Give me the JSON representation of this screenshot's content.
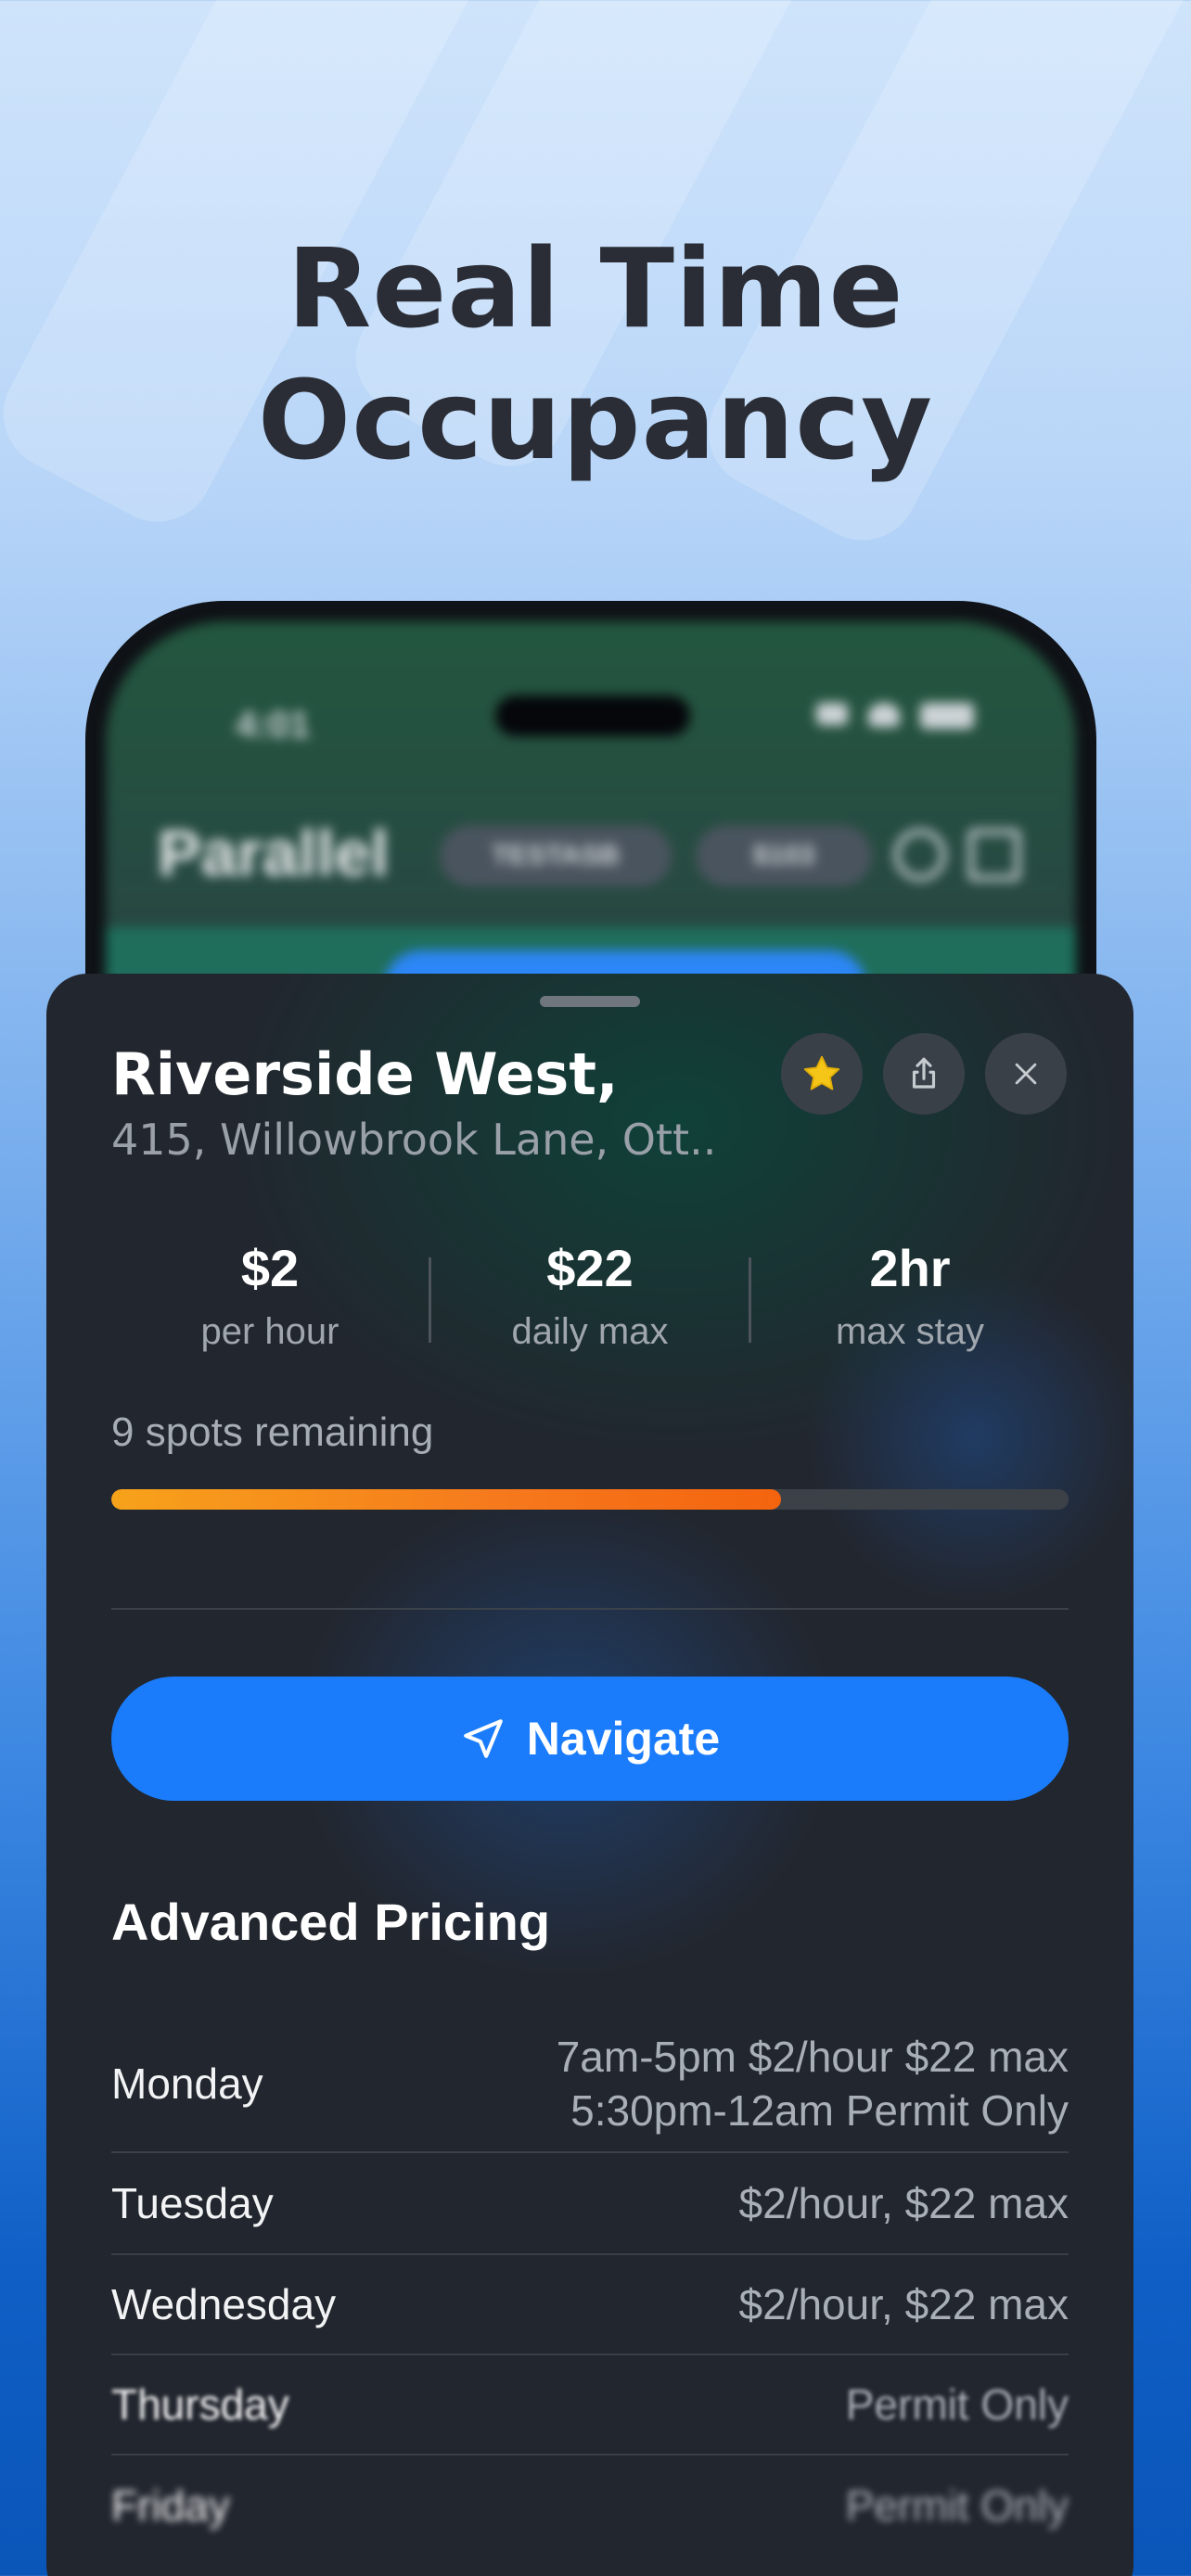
{
  "headline": {
    "line1": "Real Time",
    "line2": "Occupancy"
  },
  "phone": {
    "status_time": "4:01",
    "app_name": "Parallel",
    "chips": [
      "TESTASB",
      "$103"
    ]
  },
  "sheet": {
    "place_name": "Riverside West,",
    "address": "415, Willowbrook Lane, Ott..",
    "buttons": {
      "favorite": "star-icon",
      "share": "share-icon",
      "close": "close-icon"
    },
    "stats": [
      {
        "value": "$2",
        "label": "per hour"
      },
      {
        "value": "$22",
        "label": "daily max"
      },
      {
        "value": "2hr",
        "label": "max stay"
      }
    ],
    "spots_text": "9 spots remaining",
    "occupancy_fraction": 0.7,
    "navigate_label": "Navigate",
    "advanced_title": "Advanced Pricing",
    "pricing": [
      {
        "day": "Monday",
        "line1": "7am-5pm $2/hour $22 max",
        "line2": "5:30pm-12am Permit Only"
      },
      {
        "day": "Tuesday",
        "line1": "$2/hour, $22 max"
      },
      {
        "day": "Wednesday",
        "line1": "$2/hour, $22 max"
      },
      {
        "day": "Thursday",
        "line1": "Permit Only"
      },
      {
        "day": "Friday",
        "line1": "Permit Only"
      }
    ]
  },
  "colors": {
    "accent": "#1a7cfb",
    "progress": "#f6781d",
    "star": "#f5c518"
  }
}
